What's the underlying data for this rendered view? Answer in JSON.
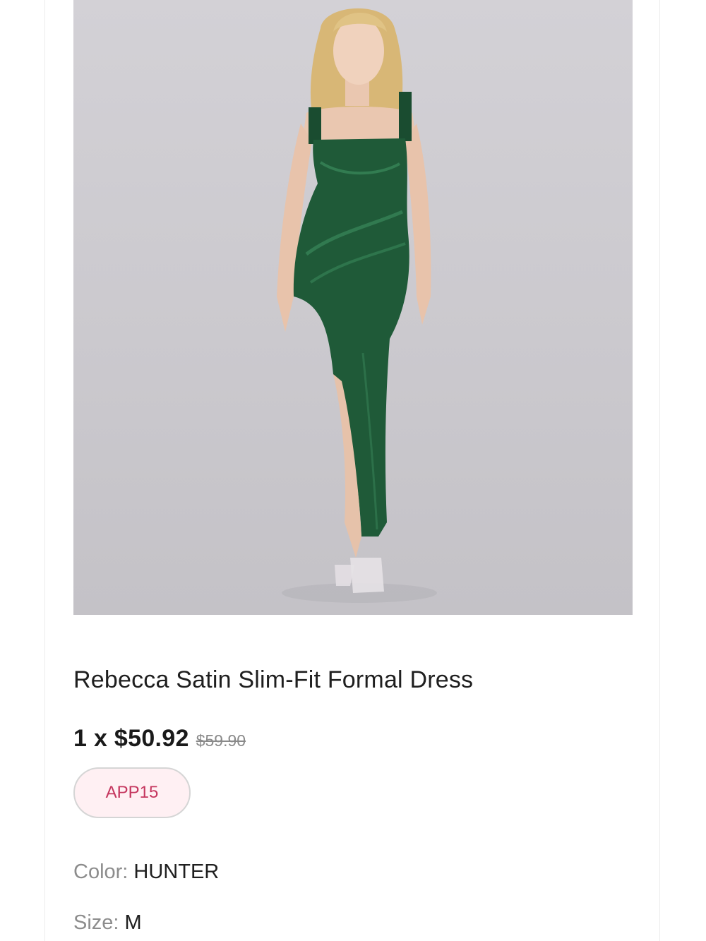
{
  "product": {
    "title": "Rebecca Satin Slim-Fit Formal Dress",
    "price_line": "1 x $50.92",
    "original_price": "$59.90",
    "promo_code": "APP15",
    "color_label": "Color:",
    "color_value": "HUNTER",
    "size_label": "Size:",
    "size_value": "M",
    "image_icon": "product-photo",
    "colors": {
      "dress": "#1f5a38",
      "promo_text": "#c5365e",
      "promo_bg": "#fff0f3",
      "background": "#d3d1d6"
    }
  }
}
